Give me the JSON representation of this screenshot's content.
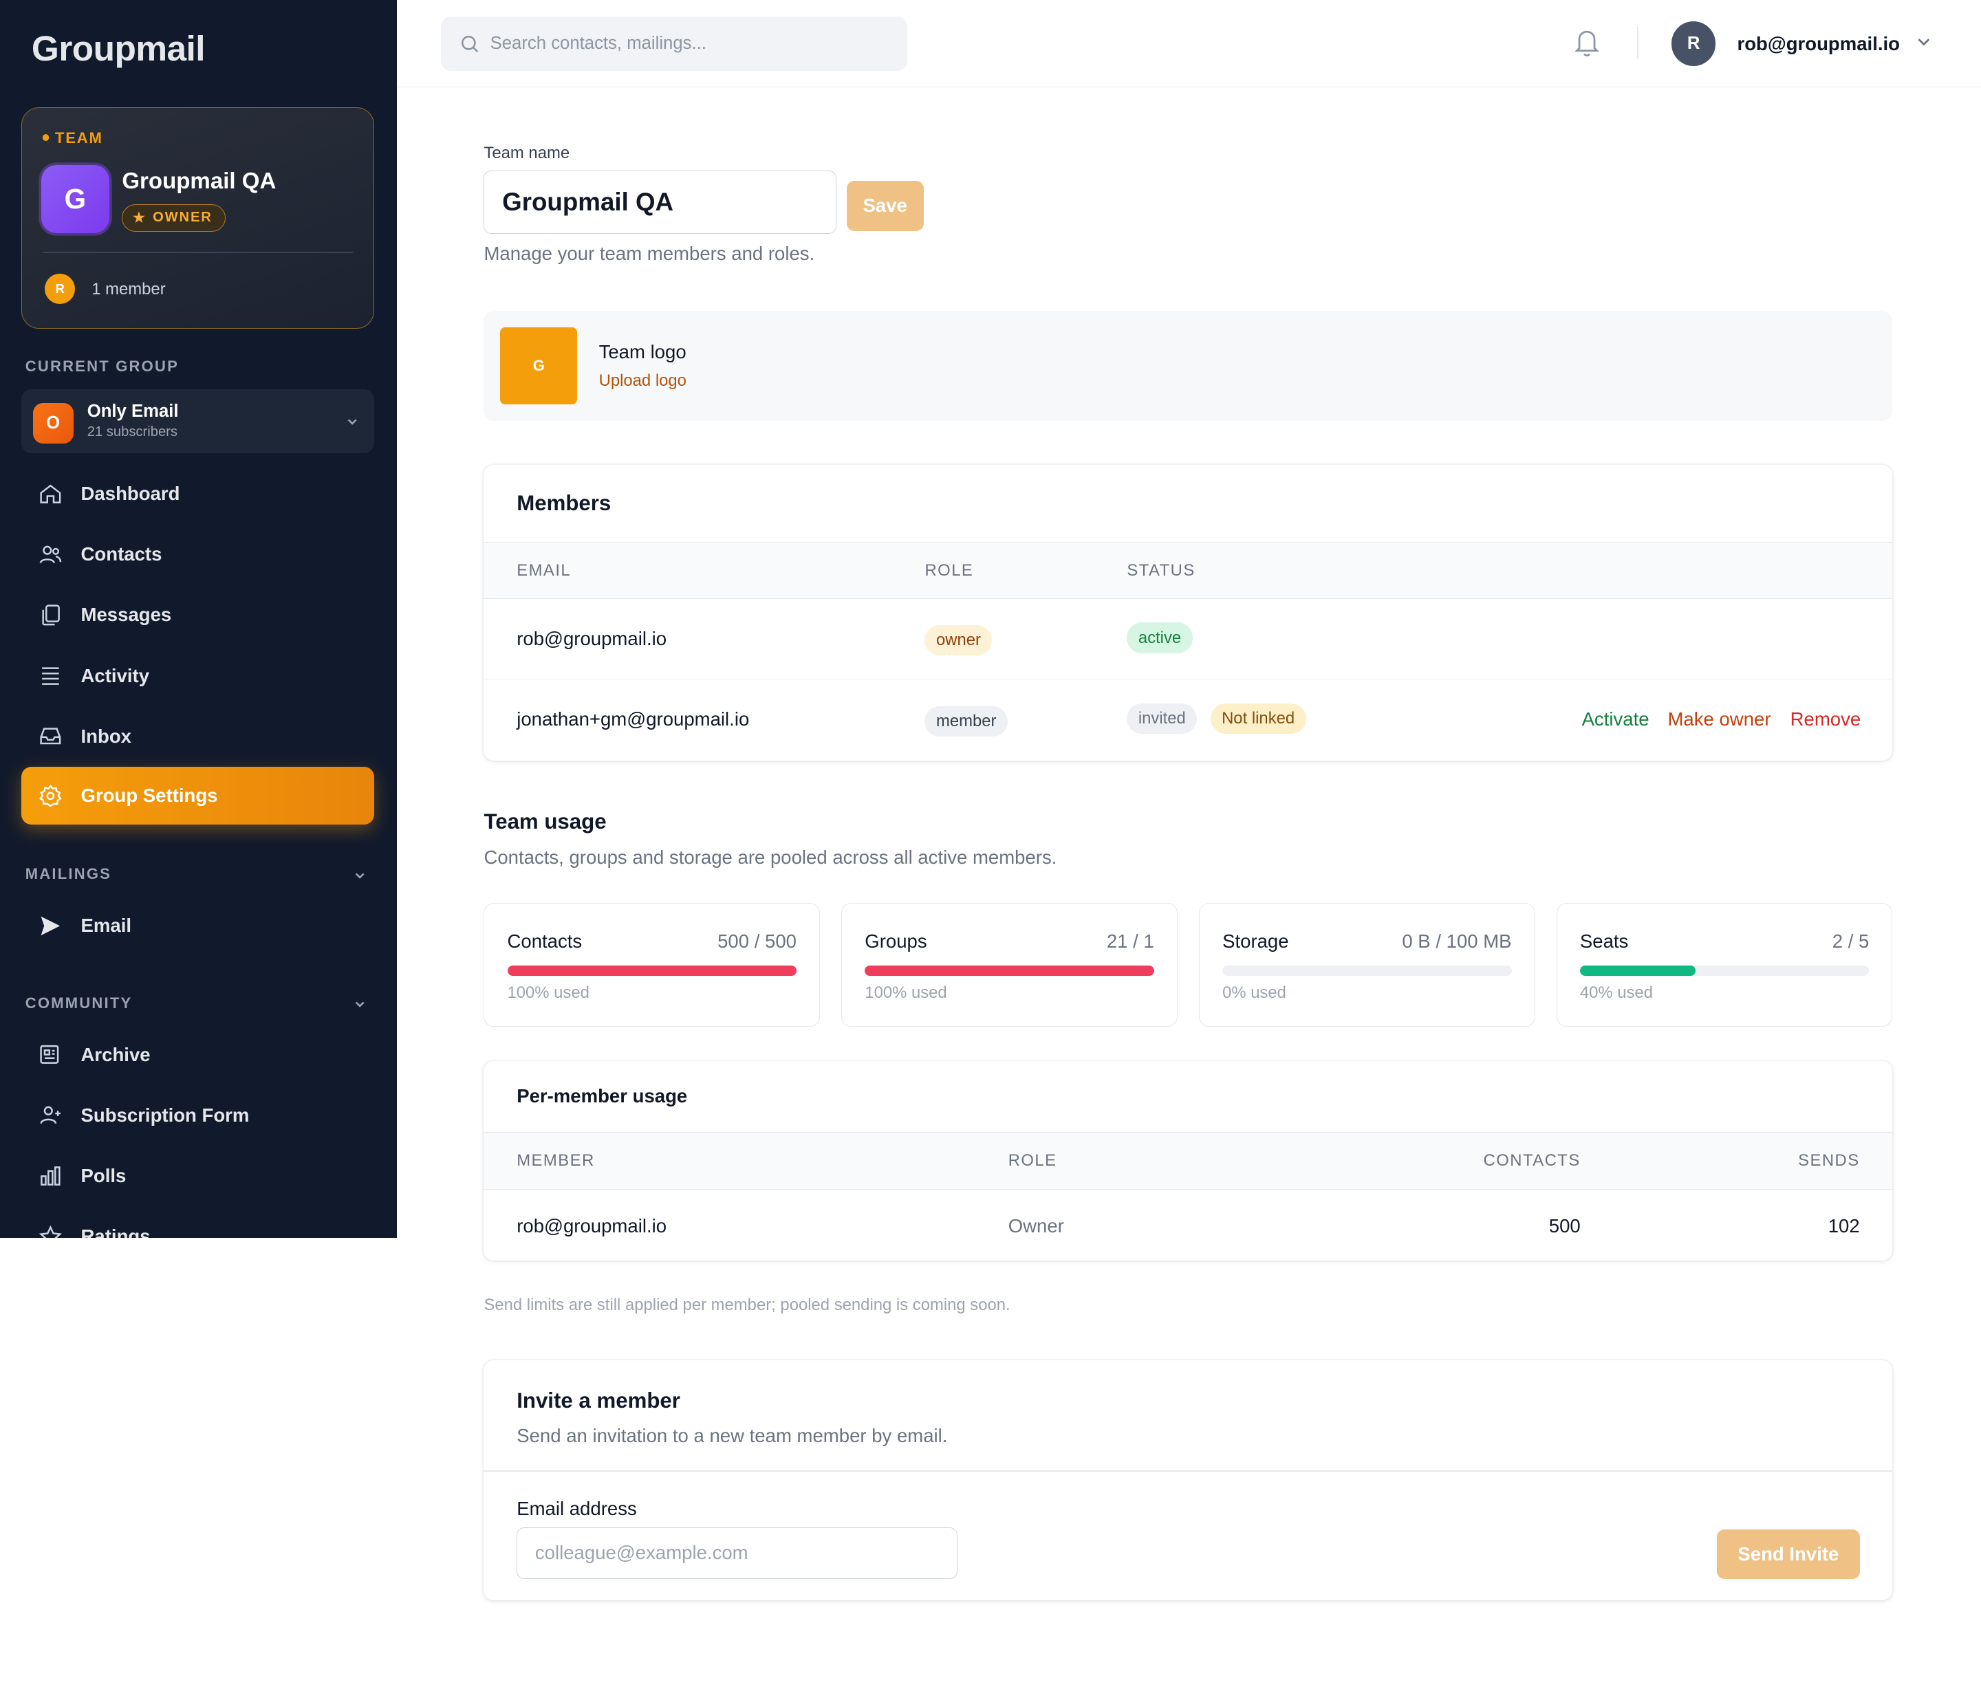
{
  "app": {
    "brand": "Groupmail"
  },
  "team_card": {
    "tag": "TEAM",
    "initial": "G",
    "name": "Groupmail QA",
    "role": "OWNER",
    "member_initial": "R",
    "member_count": "1 member"
  },
  "current_group": {
    "label": "CURRENT GROUP",
    "initial": "O",
    "name": "Only Email",
    "subscribers": "21 subscribers"
  },
  "nav": {
    "main": [
      {
        "label": "Dashboard",
        "icon": "home-icon"
      },
      {
        "label": "Contacts",
        "icon": "users-icon"
      },
      {
        "label": "Messages",
        "icon": "copy-icon"
      },
      {
        "label": "Activity",
        "icon": "list-icon"
      },
      {
        "label": "Inbox",
        "icon": "inbox-icon"
      },
      {
        "label": "Group Settings",
        "icon": "gear-icon",
        "active": true
      }
    ],
    "mailings_label": "MAILINGS",
    "mailings": [
      {
        "label": "Email",
        "icon": "send-icon"
      }
    ],
    "community_label": "COMMUNITY",
    "community": [
      {
        "label": "Archive",
        "icon": "newspaper-icon"
      },
      {
        "label": "Subscription Form",
        "icon": "user-plus-icon"
      },
      {
        "label": "Polls",
        "icon": "bar-chart-icon"
      },
      {
        "label": "Ratings",
        "icon": "star-icon"
      }
    ]
  },
  "topbar": {
    "search_placeholder": "Search contacts, mailings...",
    "user_initial": "R",
    "user_email": "rob@groupmail.io"
  },
  "settings": {
    "team_name_label": "Team name",
    "team_name_value": "Groupmail QA",
    "save_label": "Save",
    "description": "Manage your team members and roles.",
    "logo_initial": "G",
    "logo_title": "Team logo",
    "logo_upload": "Upload logo"
  },
  "members": {
    "title": "Members",
    "headers": {
      "email": "EMAIL",
      "role": "ROLE",
      "status": "STATUS"
    },
    "rows": [
      {
        "email": "rob@groupmail.io",
        "role": "owner",
        "status": "active"
      },
      {
        "email": "jonathan+gm@groupmail.io",
        "role": "member",
        "status": "invited",
        "extra": "Not linked",
        "actions": {
          "activate": "Activate",
          "make_owner": "Make owner",
          "remove": "Remove"
        }
      }
    ]
  },
  "team_usage": {
    "title": "Team usage",
    "subtitle": "Contacts, groups and storage are pooled across all active members.",
    "cards": [
      {
        "title": "Contacts",
        "value": "500 / 500",
        "pct_label": "100% used",
        "fraction": 1.0,
        "color": "#ef3e5c"
      },
      {
        "title": "Groups",
        "value": "21 / 1",
        "pct_label": "100% used",
        "fraction": 1.0,
        "color": "#ef3e5c"
      },
      {
        "title": "Storage",
        "value": "0 B / 100 MB",
        "pct_label": "0% used",
        "fraction": 0.0,
        "color": "#10b981"
      },
      {
        "title": "Seats",
        "value": "2 / 5",
        "pct_label": "40% used",
        "fraction": 0.4,
        "color": "#10b981"
      }
    ]
  },
  "per_member": {
    "title": "Per-member usage",
    "headers": {
      "member": "MEMBER",
      "role": "ROLE",
      "contacts": "CONTACTS",
      "sends": "SENDS"
    },
    "rows": [
      {
        "member": "rob@groupmail.io",
        "role": "Owner",
        "contacts": "500",
        "sends": "102"
      }
    ],
    "note": "Send limits are still applied per member; pooled sending is coming soon."
  },
  "invite": {
    "title": "Invite a member",
    "subtitle": "Send an invitation to a new team member by email.",
    "email_label": "Email address",
    "email_placeholder": "colleague@example.com",
    "button": "Send Invite"
  }
}
